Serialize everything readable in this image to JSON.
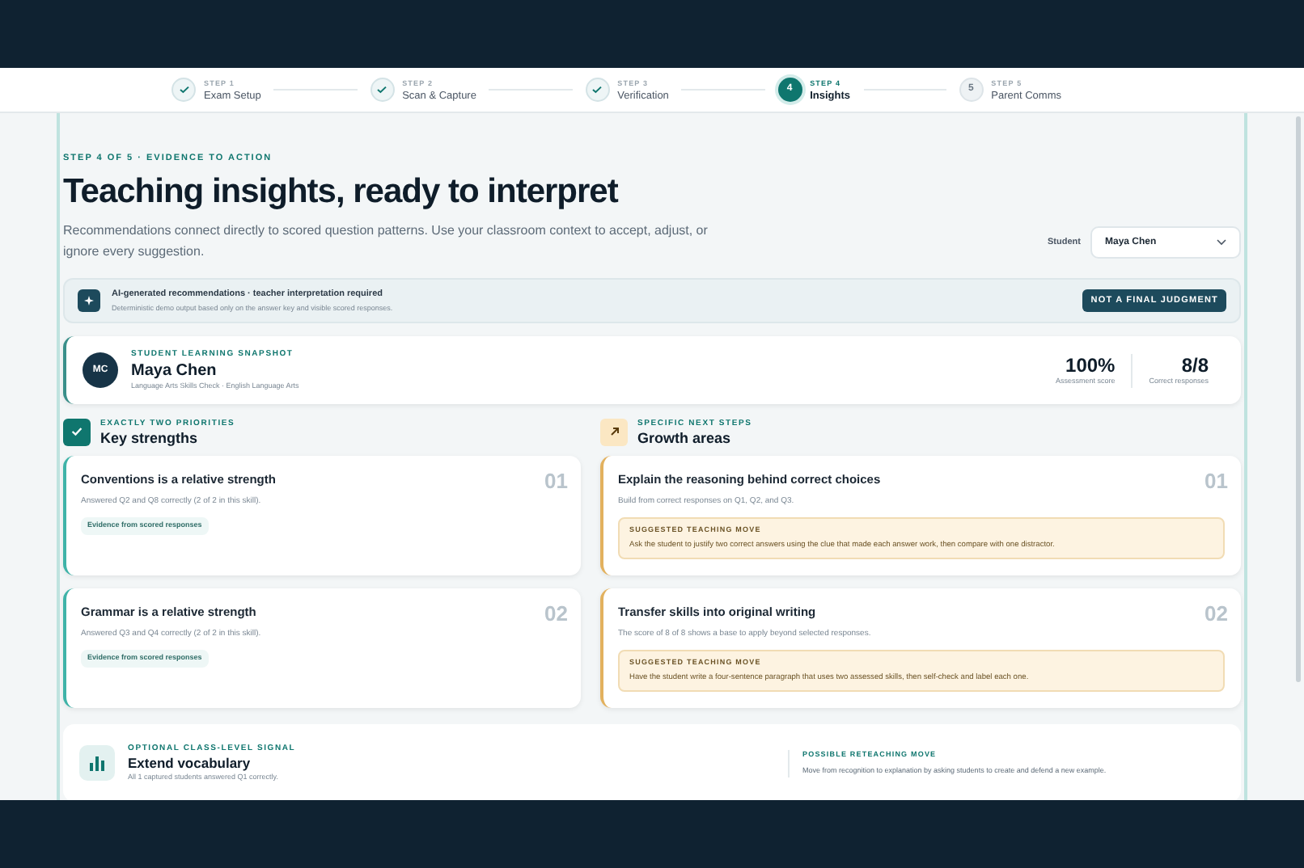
{
  "steps": [
    {
      "step": "STEP 1",
      "label": "Exam Setup",
      "completed": true,
      "selected": false
    },
    {
      "step": "STEP 2",
      "label": "Scan & Capture",
      "completed": true,
      "selected": false
    },
    {
      "step": "STEP 3",
      "label": "Verification",
      "completed": true,
      "selected": false
    },
    {
      "step": "STEP 4",
      "label": "Insights",
      "number": "4",
      "completed": false,
      "selected": true
    },
    {
      "step": "STEP 5",
      "label": "Parent Comms",
      "number": "5",
      "completed": false,
      "selected": false
    }
  ],
  "eyebrow": "STEP 4 OF 5 · EVIDENCE TO ACTION",
  "title": "Teaching insights, ready to interpret",
  "intro": "Recommendations connect directly to scored question patterns. Use your classroom context to accept, adjust, or ignore every suggestion.",
  "student_select": {
    "label": "Student",
    "value": "Maya Chen"
  },
  "notice": {
    "title": "AI-generated recommendations · teacher interpretation required",
    "subtitle": "Deterministic demo output based only on the answer key and visible scored responses.",
    "badge": "NOT A FINAL JUDGMENT"
  },
  "snapshot": {
    "initials": "MC",
    "eyebrow": "STUDENT LEARNING SNAPSHOT",
    "name": "Maya Chen",
    "subtitle": "Language Arts Skills Check · English Language Arts",
    "stats": [
      {
        "value": "100%",
        "label": "Assessment score"
      },
      {
        "value": "8/8",
        "label": "Correct responses"
      }
    ]
  },
  "strengths": {
    "eyebrow": "EXACTLY TWO PRIORITIES",
    "title": "Key strengths",
    "items": [
      {
        "number": "01",
        "title": "Conventions is a relative strength",
        "detail": "Answered Q2 and Q8 correctly (2 of 2 in this skill).",
        "tag": "Evidence from scored responses"
      },
      {
        "number": "02",
        "title": "Grammar is a relative strength",
        "detail": "Answered Q3 and Q4 correctly (2 of 2 in this skill).",
        "tag": "Evidence from scored responses"
      }
    ]
  },
  "growth": {
    "eyebrow": "SPECIFIC NEXT STEPS",
    "title": "Growth areas",
    "items": [
      {
        "number": "01",
        "title": "Explain the reasoning behind correct choices",
        "detail": "Build from correct responses on Q1, Q2, and Q3.",
        "move_label": "SUGGESTED TEACHING MOVE",
        "move": "Ask the student to justify two correct answers using the clue that made each answer work, then compare with one distractor."
      },
      {
        "number": "02",
        "title": "Transfer skills into original writing",
        "detail": "The score of 8 of 8 shows a base to apply beyond selected responses.",
        "move_label": "SUGGESTED TEACHING MOVE",
        "move": "Have the student write a four-sentence paragraph that uses two assessed skills, then self-check and label each one."
      }
    ]
  },
  "class_signal": {
    "eyebrow": "OPTIONAL CLASS-LEVEL SIGNAL",
    "title": "Extend vocabulary",
    "detail": "All 1 captured students answered Q1 correctly.",
    "move_label": "POSSIBLE RETEACHING MOVE",
    "move": "Move from recognition to explanation by asking students to create and defend a new example."
  }
}
